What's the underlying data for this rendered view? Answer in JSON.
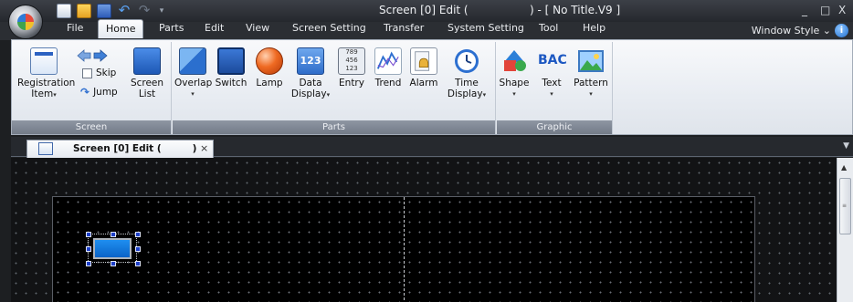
{
  "window": {
    "title_left": "Screen [0] Edit (",
    "title_right": ") - [ No Title.V9 ]",
    "min_glyph": "_",
    "max_glyph": "□",
    "close_glyph": "X"
  },
  "quick_access": [
    "new-icon",
    "open-icon",
    "save-icon",
    "undo-icon",
    "redo-icon"
  ],
  "menu": {
    "tabs": [
      "File",
      "Home",
      "Parts",
      "Edit",
      "View",
      "Screen Setting",
      "Transfer",
      "System Setting",
      "Tool",
      "Help"
    ],
    "active": "Home",
    "window_style": "Window Style",
    "window_style_caret": "⌄",
    "help_glyph": "i"
  },
  "ribbon": {
    "screen_group": {
      "label": "Screen",
      "registration": [
        "Registration",
        "Item"
      ],
      "skip": "Skip",
      "jump": "Jump",
      "screen_list": [
        "Screen",
        "List"
      ]
    },
    "parts_group": {
      "label": "Parts",
      "overlap": "Overlap",
      "switch": "Switch",
      "lamp": "Lamp",
      "data_display": [
        "Data",
        "Display"
      ],
      "data_icon_text": "123",
      "entry": "Entry",
      "entry_icon_text": "789 456 123",
      "trend": "Trend",
      "alarm": "Alarm",
      "time_display": [
        "Time",
        "Display"
      ]
    },
    "graphic_group": {
      "label": "Graphic",
      "shape": "Shape",
      "text": "Text",
      "text_icon_text": "BAC",
      "pattern": "Pattern"
    }
  },
  "document_tab": {
    "title_left": "Screen [0] Edit (",
    "title_right": ")",
    "close": "×"
  },
  "colors": {
    "titlebar": "#2b2e33",
    "ribbon_bg": "#e8ecf2",
    "canvas_bg": "#121315",
    "screen_bg": "#000000",
    "selected_part": "#1f8ff0",
    "handle": "#1e40c8"
  }
}
